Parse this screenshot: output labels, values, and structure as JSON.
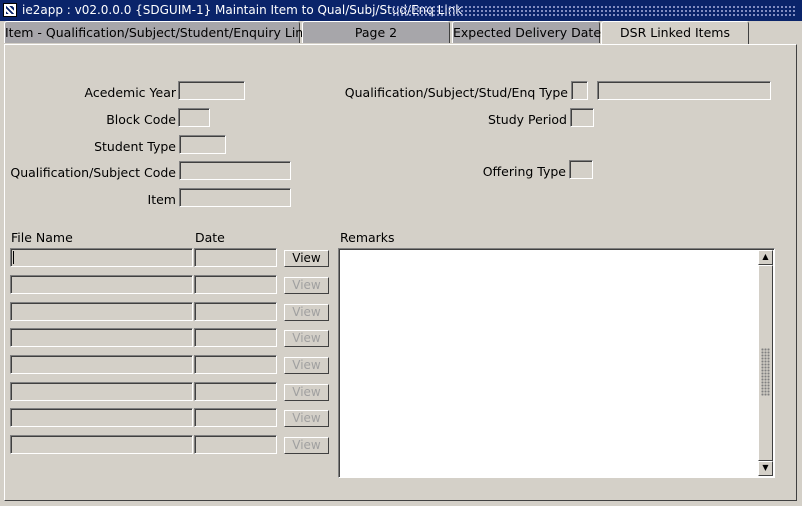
{
  "window": {
    "title": "ie2app : v02.0.0.0 {SDGUIM-1} Maintain Item to Qual/Subj/Stud/Enq Link"
  },
  "tabs": [
    {
      "label": "Item - Qualification/Subject/Student/Enquiry Link"
    },
    {
      "label": "Page 2"
    },
    {
      "label": "Expected Delivery Date"
    },
    {
      "label": "DSR Linked Items"
    }
  ],
  "form": {
    "academic_year": {
      "label": "Acedemic Year",
      "value": ""
    },
    "block_code": {
      "label": "Block Code",
      "value": ""
    },
    "student_type": {
      "label": "Student Type",
      "value": ""
    },
    "qual_subject_code": {
      "label": "Qualification/Subject Code",
      "value": ""
    },
    "item": {
      "label": "Item",
      "value": ""
    },
    "qsse_type": {
      "label": "Qualification/Subject/Stud/Enq Type",
      "code": "",
      "description": ""
    },
    "study_period": {
      "label": "Study Period",
      "value": ""
    },
    "offering_type": {
      "label": "Offering Type",
      "value": ""
    }
  },
  "files": {
    "headers": {
      "file_name": "File Name",
      "date": "Date",
      "remarks": "Remarks"
    },
    "view_label": "View",
    "rows": [
      {
        "file_name": "",
        "date": ""
      },
      {
        "file_name": "",
        "date": ""
      },
      {
        "file_name": "",
        "date": ""
      },
      {
        "file_name": "",
        "date": ""
      },
      {
        "file_name": "",
        "date": ""
      },
      {
        "file_name": "",
        "date": ""
      },
      {
        "file_name": "",
        "date": ""
      },
      {
        "file_name": "",
        "date": ""
      }
    ],
    "remarks": ""
  }
}
